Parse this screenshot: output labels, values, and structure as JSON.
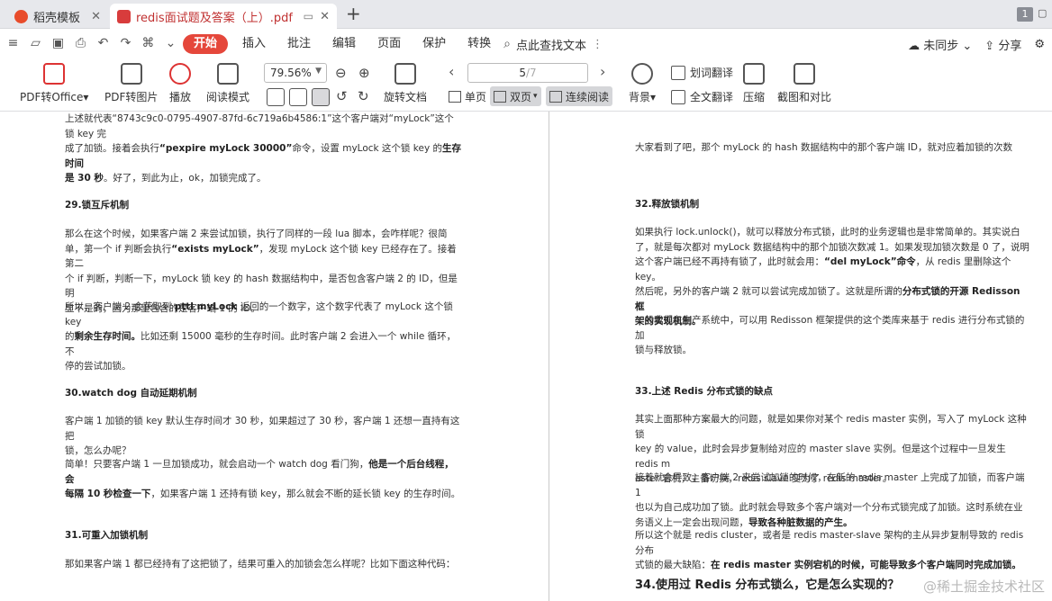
{
  "tabs": [
    {
      "label": "稻壳模板"
    },
    {
      "label": "redis面试题及答案（上）.pdf"
    }
  ],
  "page_badge": "1",
  "menu": {
    "items": [
      "开始",
      "插入",
      "批注",
      "编辑",
      "页面",
      "保护",
      "转换"
    ],
    "search_label": "点此查找文本",
    "sync_label": "未同步",
    "share_label": "分享"
  },
  "ribbon": {
    "pdf_to_office": "PDF转Office",
    "pdf_to_image": "PDF转图片",
    "play": "播放",
    "read_mode": "阅读模式",
    "zoom_value": "79.56%",
    "rotate_doc": "旋转文档",
    "page_current": "5",
    "page_total": "/7",
    "single_page": "单页",
    "double_page": "双页",
    "continuous": "连续阅读",
    "background": "背景",
    "word_translate": "划词翻译",
    "full_translate": "全文翻译",
    "compress": "压缩",
    "screenshot_compare": "截图和对比"
  },
  "left_page": {
    "p0a": "上述就代表“8743c9c0-0795-4907-87fd-6c719a6b4586:1”这个客户端对“myLock”这个锁 key 完",
    "p0b_pre": "成了加锁。接着会执行",
    "p0b_bold": "“pexpire myLock 30000”",
    "p0b_mid": "命令，设置 myLock 这个锁 key 的",
    "p0b_bold2": "生存时间",
    "p0c_bold": "是 30 秒",
    "p0c_post": "。好了，到此为止，ok，加锁完成了。",
    "h29": "29.锁互斥机制",
    "p29a": "那么在这个时候，如果客户端 2 来尝试加锁，执行了同样的一段 lua 脚本，会咋样呢？很简",
    "p29b_pre": "单，第一个 if 判断会执行",
    "p29b_bold": "“exists myLock”",
    "p29b_post": "，发现 myLock 这个锁 key 已经存在了。接着第二",
    "p29c": "个 if 判断，判断一下，myLock 锁 key 的 hash 数据结构中，是否包含客户端 2 的 ID，但是明",
    "p29d": "显不是的，因为那里包含的是客户端 1 的 ID。",
    "p29e_pre": "所以，客户端 2 会获取到 ",
    "p29e_bold": "pttl myLock",
    "p29e_post": " 返回的一个数字，这个数字代表了 myLock 这个锁 key",
    "p29f_pre": "的",
    "p29f_bold": "剩余生存时间。",
    "p29f_post": "比如还剩 15000 毫秒的生存时间。此时客户端 2 会进入一个 while 循环，不",
    "p29g": "停的尝试加锁。",
    "h30": "30.watch dog 自动延期机制",
    "p30a": "客户端 1 加锁的锁 key 默认生存时间才 30 秒，如果超过了 30 秒，客户端 1 还想一直持有这把",
    "p30b": "锁，怎么办呢？",
    "p30c_pre": "简单！只要客户端 1 一旦加锁成功，就会启动一个 watch dog 看门狗，",
    "p30c_bold": "他是一个后台线程，会",
    "p30d_bold": "每隔 10 秒检查一下",
    "p30d_post": "，如果客户端 1 还持有锁 key，那么就会不断的延长锁 key 的生存时间。",
    "h31": "31.可重入加锁机制",
    "p31a": "那如果客户端 1 都已经持有了这把锁了，结果可重入的加锁会怎么样呢？比如下面这种代码："
  },
  "right_page": {
    "p0": "大家看到了吧，那个 myLock 的 hash 数据结构中的那个客户端 ID，就对应着加锁的次数",
    "h32": "32.释放锁机制",
    "p32a": "如果执行 lock.unlock()，就可以释放分布式锁，此时的业务逻辑也是非常简单的。其实说白",
    "p32b": "了，就是每次都对 myLock 数据结构中的那个加锁次数减 1。如果发现加锁次数是 0 了，说明",
    "p32c_pre": "这个客户端已经不再持有锁了，此时就会用：",
    "p32c_bold": "“del myLock”命令",
    "p32c_post": "，从 redis 里删除这个 key。",
    "p32d_pre": "然后呢，另外的客户端 2 就可以尝试完成加锁了。这就是所谓的",
    "p32d_bold": "分布式锁的开源 Redisson 框",
    "p32e_bold": "架的实现机制。",
    "p32f": "一般我们在生产系统中，可以用 Redisson 框架提供的这个类库来基于 redis 进行分布式锁的加",
    "p32g": "锁与释放锁。",
    "h33": "33.上述 Redis 分布式锁的缺点",
    "p33a": "其实上面那种方案最大的问题，就是如果你对某个 redis master 实例，写入了 myLock 这种锁",
    "p33b": "key 的 value，此时会异步复制给对应的 master slave 实例。但是这个过程中一旦发生 redis m",
    "p33c": "aster 宕机，主备切换，redis slave 变为了 redis master。",
    "p33d": "接着就会导致，客户端 2 来尝试加锁的时候，在新的 redis master 上完成了加锁，而客户端 1",
    "p33e": "也以为自己成功加了锁。此时就会导致多个客户端对一个分布式锁完成了加锁。这时系统在业",
    "p33f_pre": "务语义上一定会出现问题，",
    "p33f_bold": "导致各种脏数据的产生。",
    "p33g": "所以这个就是 redis cluster，或者是 redis master-slave 架构的主从异步复制导致的 redis 分布",
    "p33h_pre": "式锁的最大缺陷：",
    "p33h_bold": "在 redis master 实例宕机的时候，可能导致多个客户端同时完成加锁。",
    "h34": "34.使用过 Redis 分布式锁么，它是怎么实现的？"
  },
  "watermark": "@稀土掘金技术社区"
}
